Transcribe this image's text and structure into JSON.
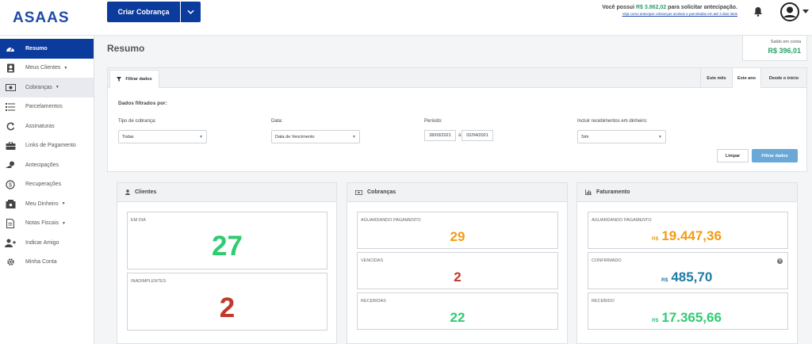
{
  "header": {
    "logo_text": "ASAAS",
    "create_button": "Criar Cobrança",
    "anticipation_prefix": "Você possui ",
    "anticipation_amount": "R$ 3.862,02",
    "anticipation_suffix": " para solicitar antecipação.",
    "anticipation_link": "Veja como antecipar cobranças avulsas e parceladas em até 3 dias úteis"
  },
  "sidebar": {
    "items": [
      {
        "label": "Resumo",
        "icon": "dashboard-icon",
        "active": true
      },
      {
        "label": "Meus Clientes",
        "icon": "contacts-icon",
        "dropdown": true
      },
      {
        "label": "Cobranças",
        "icon": "money-icon",
        "dropdown": true
      },
      {
        "label": "Parcelamentos",
        "icon": "list-icon"
      },
      {
        "label": "Assinaturas",
        "icon": "refresh-icon"
      },
      {
        "label": "Links de Pagamento",
        "icon": "briefcase-icon"
      },
      {
        "label": "Antecipações",
        "icon": "handshake-icon"
      },
      {
        "label": "Recuperações",
        "icon": "dollar-cycle-icon"
      },
      {
        "label": "Meu Dinheiro",
        "icon": "safe-icon",
        "dropdown": true
      },
      {
        "label": "Notas Fiscais",
        "icon": "invoice-icon",
        "dropdown": true
      },
      {
        "label": "Indicar Amigo",
        "icon": "add-user-icon"
      },
      {
        "label": "Minha Conta",
        "icon": "gear-icon"
      }
    ]
  },
  "main": {
    "title": "Resumo",
    "balance_label": "Saldo em conta",
    "balance_value": "R$ 396,01"
  },
  "filters": {
    "tab_label": "Filtrar dados",
    "range_buttons": [
      "Este mês",
      "Este ano",
      "Desde o início"
    ],
    "heading": "Dados filtrados por:",
    "type_label": "Tipo de cobrança:",
    "type_value": "Todas",
    "date_label": "Data:",
    "date_value": "Data de Vencimento",
    "period_label": "Período:",
    "period_start": "28/03/2021",
    "period_sep": "à",
    "period_end": "02/04/2021",
    "cash_label": "Incluir recebimentos em dinheiro:",
    "cash_value": "Sim",
    "clear_button": "Limpar",
    "apply_button": "Filtrar dados"
  },
  "cards": {
    "clients": {
      "title": "Clientes",
      "up_to_date_label": "EM DIA",
      "up_to_date_value": "27",
      "defaulting_label": "INADIMPLENTES",
      "defaulting_value": "2"
    },
    "charges": {
      "title": "Cobranças",
      "awaiting_label": "AGUARDANDO PAGAMENTO",
      "awaiting_value": "29",
      "overdue_label": "VENCIDAS",
      "overdue_value": "2",
      "received_label": "RECEBIDAS",
      "received_value": "22"
    },
    "billing": {
      "title": "Faturamento",
      "currency": "R$",
      "awaiting_label": "AGUARDANDO PAGAMENTO",
      "awaiting_value": "19.447,36",
      "confirmed_label": "CONFIRMADO",
      "confirmed_value": "485,70",
      "received_label": "RECEBIDO",
      "received_value": "17.365,66"
    }
  },
  "colors": {
    "brand_blue": "#0b3b9c",
    "green": "#2ecc71",
    "red": "#c0392b",
    "orange": "#f39c12",
    "teal": "#1f7aa6"
  }
}
